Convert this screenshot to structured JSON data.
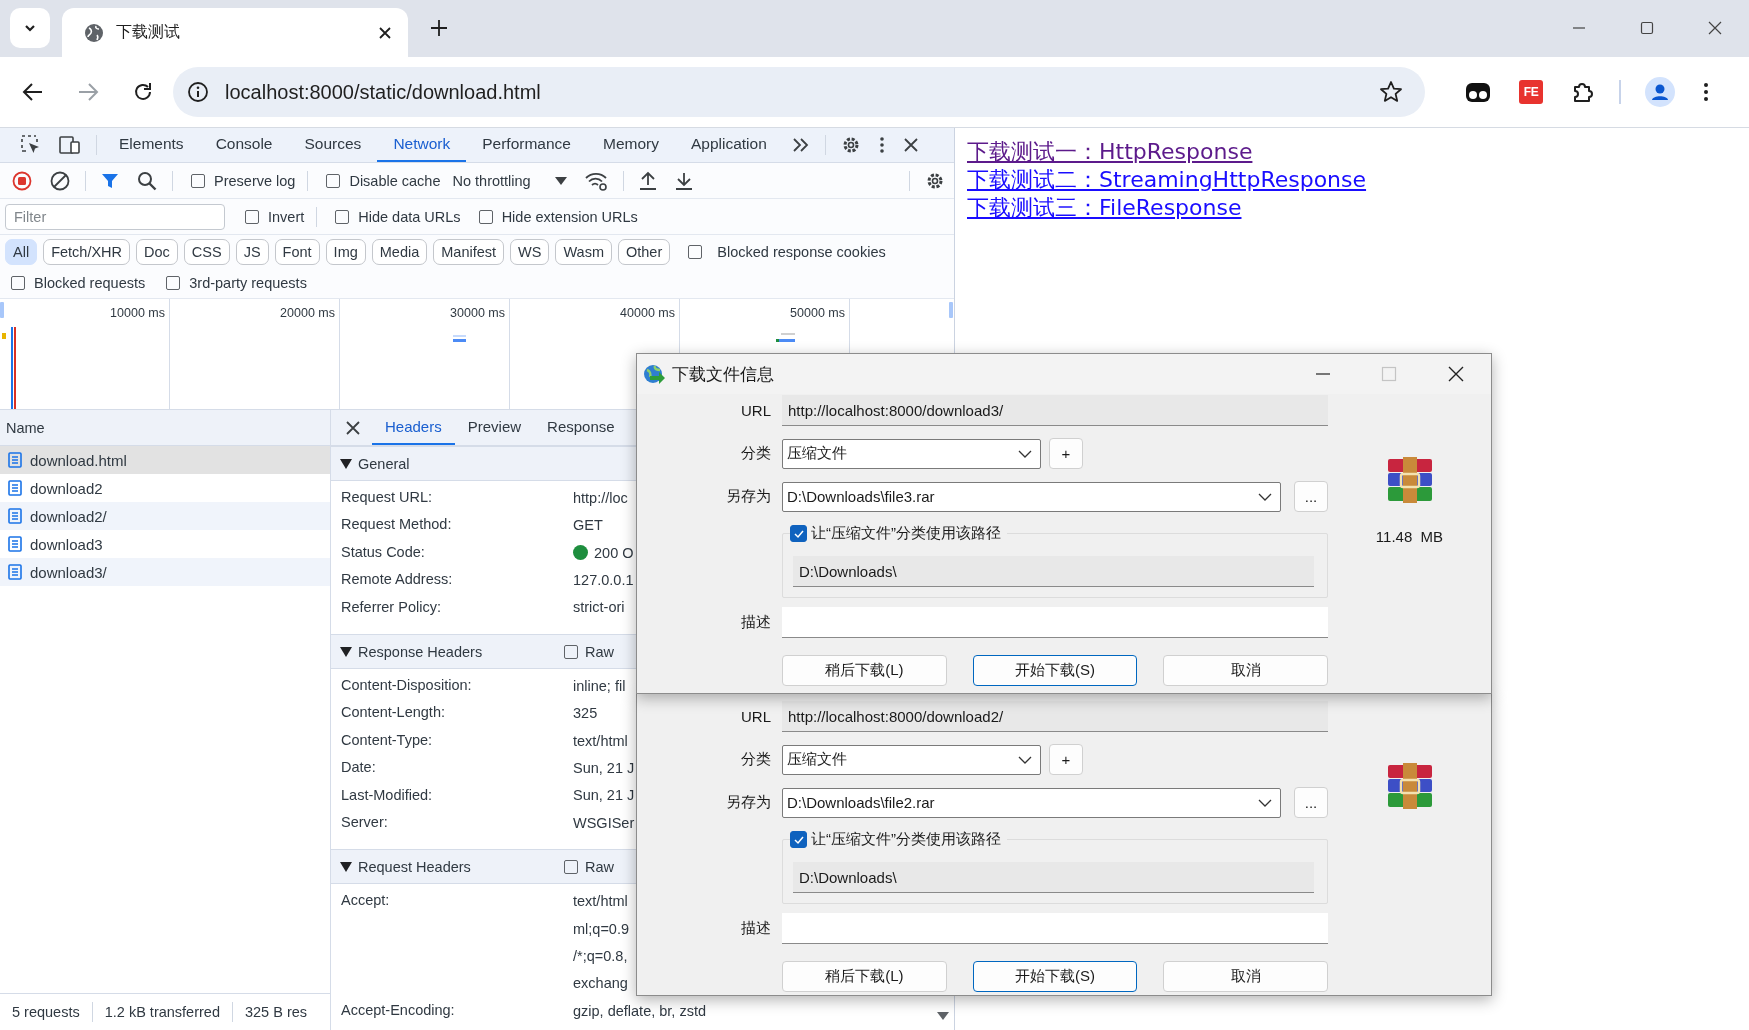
{
  "browser": {
    "tab_title": "下载测试",
    "address": "localhost:8000/static/download.html",
    "extensions": [
      {
        "kind": "glasses"
      },
      {
        "kind": "badge",
        "text": "FE"
      },
      {
        "kind": "puzzle"
      }
    ]
  },
  "devtools": {
    "tabs": [
      {
        "label": "Elements",
        "selected": false
      },
      {
        "label": "Console",
        "selected": false
      },
      {
        "label": "Sources",
        "selected": false
      },
      {
        "label": "Network",
        "selected": true
      },
      {
        "label": "Performance",
        "selected": false
      },
      {
        "label": "Memory",
        "selected": false
      },
      {
        "label": "Application",
        "selected": false
      }
    ],
    "toolbar_checks": [
      {
        "label": "Preserve log",
        "checked": false
      },
      {
        "label": "Disable cache",
        "checked": false
      }
    ],
    "throttling": "No throttling",
    "filter": {
      "placeholder": "Filter"
    },
    "filter_checks": [
      {
        "label": "Invert",
        "checked": false
      },
      {
        "label": "Hide data URLs",
        "checked": false
      },
      {
        "label": "Hide extension URLs",
        "checked": false
      }
    ],
    "type_filters": [
      {
        "label": "All",
        "selected": true
      },
      {
        "label": "Fetch/XHR",
        "selected": false
      },
      {
        "label": "Doc",
        "selected": false
      },
      {
        "label": "CSS",
        "selected": false
      },
      {
        "label": "JS",
        "selected": false
      },
      {
        "label": "Font",
        "selected": false
      },
      {
        "label": "Img",
        "selected": false
      },
      {
        "label": "Media",
        "selected": false
      },
      {
        "label": "Manifest",
        "selected": false
      },
      {
        "label": "WS",
        "selected": false
      },
      {
        "label": "Wasm",
        "selected": false
      },
      {
        "label": "Other",
        "selected": false
      }
    ],
    "extra_checks": [
      {
        "label": "Blocked response cookies",
        "checked": false
      }
    ],
    "request_checks": [
      {
        "label": "Blocked requests",
        "checked": false
      },
      {
        "label": "3rd-party requests",
        "checked": false
      }
    ],
    "timeline": {
      "ticks": [
        "10000 ms",
        "20000 ms",
        "30000 ms",
        "40000 ms",
        "50000 ms"
      ]
    },
    "requests": {
      "column": "Name",
      "rows": [
        {
          "name": "download.html",
          "selected": true
        },
        {
          "name": "download2",
          "selected": false
        },
        {
          "name": "download2/",
          "selected": false
        },
        {
          "name": "download3",
          "selected": false
        },
        {
          "name": "download3/",
          "selected": false
        }
      ]
    },
    "summary": [
      "5 requests",
      "1.2 kB transferred",
      "325 B res"
    ],
    "detail_tabs": [
      {
        "label": "Headers",
        "selected": true
      },
      {
        "label": "Preview",
        "selected": false
      },
      {
        "label": "Response",
        "selected": false
      }
    ],
    "sections": [
      {
        "title": "General",
        "expanded": true,
        "rows": [
          {
            "name": "Request URL:",
            "values": [
              "http://loc"
            ]
          },
          {
            "name": "Request Method:",
            "values": [
              "GET"
            ]
          },
          {
            "name": "Status Code:",
            "values": [
              "200 O"
            ],
            "color": "#1e8e3e"
          },
          {
            "name": "Remote Address:",
            "values": [
              "127.0.0.1"
            ]
          },
          {
            "name": "Referrer Policy:",
            "values": [
              "strict-ori"
            ]
          }
        ]
      },
      {
        "title": "Response Headers",
        "expanded": true,
        "raw": {
          "label": "Raw",
          "checked": false
        },
        "rows": [
          {
            "name": "Content-Disposition:",
            "values": [
              "inline; fil"
            ]
          },
          {
            "name": "Content-Length:",
            "values": [
              "325"
            ]
          },
          {
            "name": "Content-Type:",
            "values": [
              "text/html"
            ]
          },
          {
            "name": "Date:",
            "values": [
              "Sun, 21 J"
            ]
          },
          {
            "name": "Last-Modified:",
            "values": [
              "Sun, 21 J"
            ]
          },
          {
            "name": "Server:",
            "values": [
              "WSGISer"
            ]
          }
        ]
      },
      {
        "title": "Request Headers",
        "expanded": true,
        "raw": {
          "label": "Raw",
          "checked": false
        },
        "rows": [
          {
            "name": "Accept:",
            "values": [
              "text/html",
              "ml;q=0.9",
              "/*;q=0.8,",
              "exchang"
            ]
          },
          {
            "name": "Accept-Encoding:",
            "values": [
              "gzip, deflate, br, zstd"
            ]
          }
        ]
      }
    ]
  },
  "page": {
    "links": [
      {
        "text": "下载测试一：HttpResponse",
        "visited": true
      },
      {
        "text": "下载测试二：StreamingHttpResponse",
        "visited": false
      },
      {
        "text": "下载测试三：FileResponse",
        "visited": false
      }
    ]
  },
  "dialogs": [
    {
      "title": "下载文件信息",
      "url_label": "URL",
      "url": "http://localhost:8000/download3/",
      "category_label": "分类",
      "category": "压缩文件",
      "add_label": "+",
      "save_label": "另存为",
      "save_path": "D:\\Downloads\\file3.rar",
      "browse_label": "...",
      "use_path": {
        "label": "让“压缩文件”分类使用该路径",
        "checked": true
      },
      "folder": "D:\\Downloads\\",
      "description_label": "描述",
      "size": "11.48  MB",
      "buttons": [
        {
          "label": "稍后下载(L)",
          "default": false
        },
        {
          "label": "开始下载(S)",
          "default": true
        },
        {
          "label": "取消",
          "default": false
        }
      ]
    },
    {
      "url_label": "URL",
      "url": "http://localhost:8000/download2/",
      "category_label": "分类",
      "category": "压缩文件",
      "add_label": "+",
      "save_label": "另存为",
      "save_path": "D:\\Downloads\\file2.rar",
      "browse_label": "...",
      "use_path": {
        "label": "让“压缩文件”分类使用该路径",
        "checked": true
      },
      "folder": "D:\\Downloads\\",
      "description_label": "描述",
      "buttons": [
        {
          "label": "稍后下载(L)",
          "default": false
        },
        {
          "label": "开始下载(S)",
          "default": true
        },
        {
          "label": "取消",
          "default": false
        }
      ]
    }
  ]
}
